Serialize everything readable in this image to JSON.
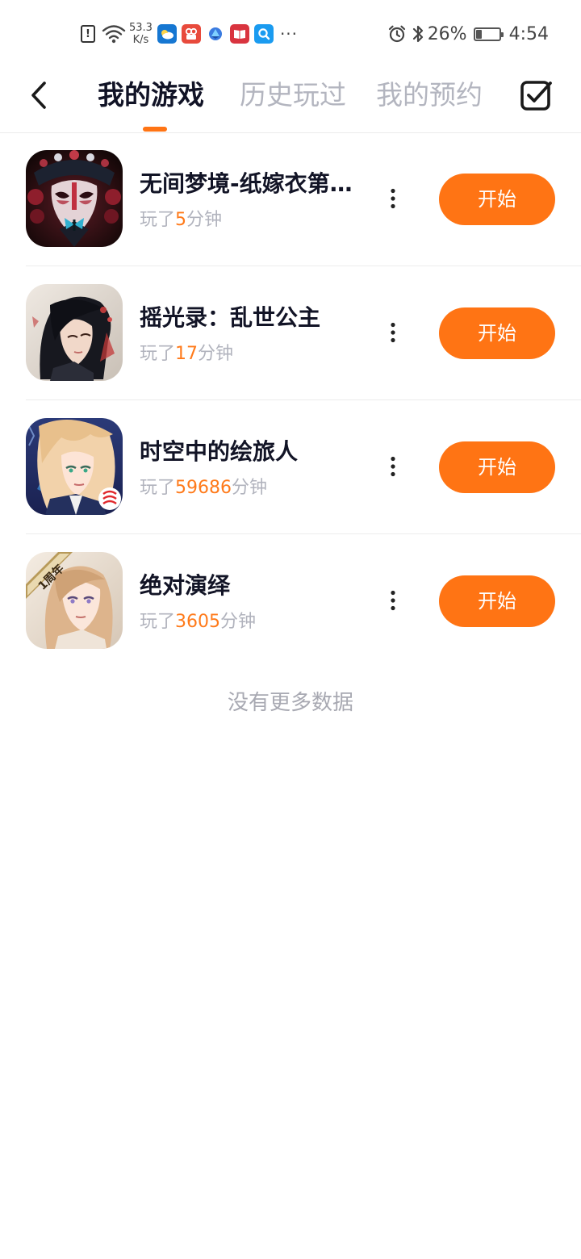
{
  "status_bar": {
    "net_speed_value": "53.3",
    "net_speed_unit": "K/s",
    "alert_icon_text": "!",
    "apps": [
      {
        "icon": "weather-icon",
        "color": "#1677d2"
      },
      {
        "icon": "video-app-icon",
        "color": "#e84a3c"
      },
      {
        "icon": "browser-app-icon",
        "color": "#3a7be0"
      },
      {
        "icon": "reader-app-icon",
        "color": "#d9343f"
      },
      {
        "icon": "search-app-icon",
        "color": "#1a9bf0"
      }
    ],
    "more_notifications": "···",
    "battery_percent": "26%",
    "battery_level": 0.26,
    "time": "4:54"
  },
  "header": {
    "tabs": [
      {
        "label": "我的游戏",
        "active": true
      },
      {
        "label": "历史玩过",
        "active": false
      },
      {
        "label": "我的预约",
        "active": false
      }
    ],
    "accent_color": "#ff7414"
  },
  "games": [
    {
      "title": "无间梦境-纸嫁衣第…",
      "played_prefix": "玩了",
      "minutes": "5",
      "played_suffix": "分钟",
      "start_label": "开始"
    },
    {
      "title": "摇光录：乱世公主",
      "played_prefix": "玩了",
      "minutes": "17",
      "played_suffix": "分钟",
      "start_label": "开始"
    },
    {
      "title": "时空中的绘旅人",
      "played_prefix": "玩了",
      "minutes": "59686",
      "played_suffix": "分钟",
      "start_label": "开始"
    },
    {
      "title": "绝对演绎",
      "played_prefix": "玩了",
      "minutes": "3605",
      "played_suffix": "分钟",
      "start_label": "开始",
      "icon_badge": "1周年"
    }
  ],
  "footer": {
    "no_more_text": "没有更多数据"
  }
}
